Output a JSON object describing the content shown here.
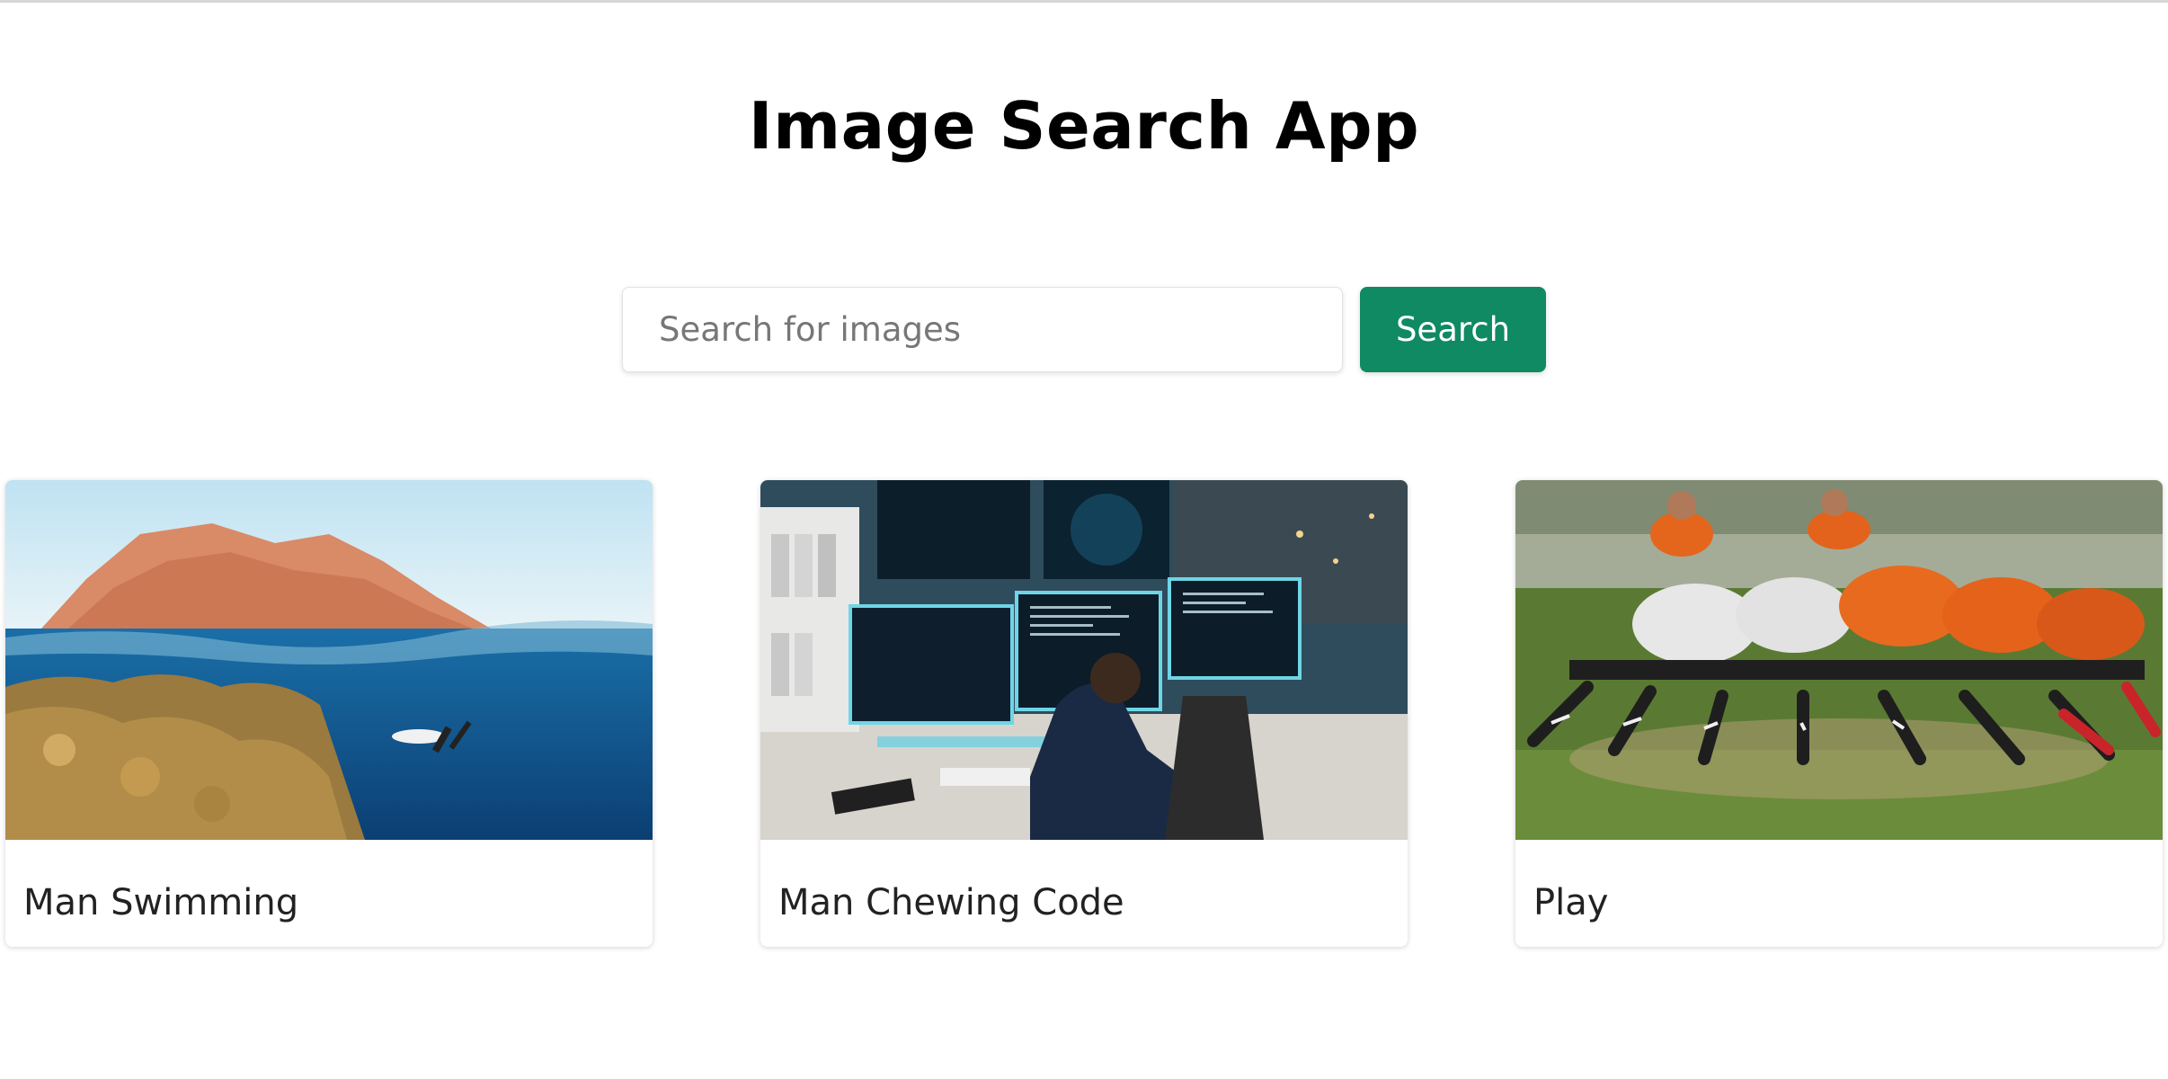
{
  "app": {
    "title": "Image Search App"
  },
  "search": {
    "placeholder": "Search for images",
    "value": "",
    "button_label": "Search"
  },
  "colors": {
    "accent": "#0f8a63"
  },
  "results": [
    {
      "caption": "Man Swimming",
      "image": "underwater-diver-coral-reef-image"
    },
    {
      "caption": "Man Chewing Code",
      "image": "programmer-at-monitors-image"
    },
    {
      "caption": "Play",
      "image": "rugby-scrum-image"
    }
  ]
}
